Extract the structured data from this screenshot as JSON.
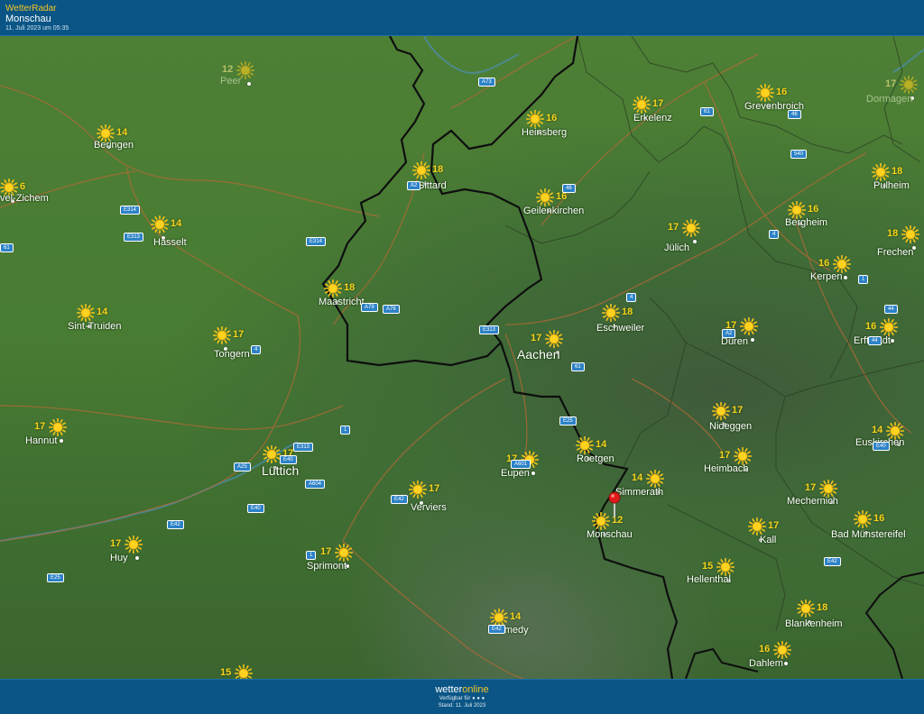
{
  "header": {
    "app_name": "WetterRadar",
    "location": "Monschau",
    "timestamp": "11. Juli 2023 um 05:35"
  },
  "footer": {
    "brand_prefix": "wetter",
    "brand_suffix": "online",
    "available": "Verfügbar für",
    "stand": "Stand: 11. Juli 2023"
  },
  "colors": {
    "header_bg": "#0a5585",
    "accent": "#f5c623",
    "map_green": "#4b7c34",
    "border": "#111111",
    "road_badge": "#2d82c6"
  },
  "pin": {
    "location": "Monschau",
    "icon": "map-pin-icon"
  },
  "cities": [
    {
      "name": "Peer",
      "temp": "12",
      "faded": true
    },
    {
      "name": "Beringen",
      "temp": "14"
    },
    {
      "name": "vel-Zichem",
      "temp": "6"
    },
    {
      "name": "Hasselt",
      "temp": "14"
    },
    {
      "name": "Sint-Truiden",
      "temp": "14"
    },
    {
      "name": "Tongern",
      "temp": "17"
    },
    {
      "name": "Hannut",
      "temp": "17"
    },
    {
      "name": "Lüttich",
      "temp": "17",
      "big": true
    },
    {
      "name": "Huy",
      "temp": "17"
    },
    {
      "name": "Sprimont",
      "temp": "17"
    },
    {
      "name": "Maastricht",
      "temp": "18"
    },
    {
      "name": "Sittard",
      "temp": "18"
    },
    {
      "name": "Heinsberg",
      "temp": "16"
    },
    {
      "name": "Erkelenz",
      "temp": "17"
    },
    {
      "name": "Grevenbroich",
      "temp": "16"
    },
    {
      "name": "Dormagen",
      "temp": "17",
      "faded": true
    },
    {
      "name": "Geilenkirchen",
      "temp": "16"
    },
    {
      "name": "Jülich",
      "temp": "17"
    },
    {
      "name": "Bergheim",
      "temp": "16"
    },
    {
      "name": "Pulheim",
      "temp": "18"
    },
    {
      "name": "Frechen",
      "temp": "18"
    },
    {
      "name": "Kerpen",
      "temp": "16"
    },
    {
      "name": "Aachen",
      "temp": "17",
      "big": true
    },
    {
      "name": "Eschweiler",
      "temp": "18"
    },
    {
      "name": "Düren",
      "temp": "17"
    },
    {
      "name": "Erftstadt",
      "temp": "16"
    },
    {
      "name": "Nideggen",
      "temp": "17"
    },
    {
      "name": "Euskirchen",
      "temp": "14"
    },
    {
      "name": "Heimbach",
      "temp": "17"
    },
    {
      "name": "Eupen",
      "temp": "17"
    },
    {
      "name": "Roetgen",
      "temp": "14"
    },
    {
      "name": "Simmerath",
      "temp": "14"
    },
    {
      "name": "Monschau",
      "temp": "12"
    },
    {
      "name": "Verviers",
      "temp": "17"
    },
    {
      "name": "Mechernich",
      "temp": "17"
    },
    {
      "name": "Kall",
      "temp": "17"
    },
    {
      "name": "Bad Münstereifel",
      "temp": "16"
    },
    {
      "name": "Hellenthal",
      "temp": "15"
    },
    {
      "name": "Blankenheim",
      "temp": "18"
    },
    {
      "name": "Malmedy",
      "temp": "14"
    },
    {
      "name": "Dahlem",
      "temp": "16"
    },
    {
      "name": "",
      "temp": "15"
    }
  ],
  "roads": [
    "A73",
    "61",
    "46",
    "540",
    "A2",
    "46",
    "E314",
    "E313",
    "E314",
    "61",
    "4",
    "1",
    "44",
    "4",
    "A2",
    "A79",
    "A76",
    "E313",
    "4",
    "61",
    "44",
    "E25",
    "1",
    "E40",
    "A601",
    "E313",
    "E40",
    "A25",
    "A604",
    "E40",
    "E42",
    "E42",
    "E25",
    "1",
    "E42",
    "E42",
    "1"
  ]
}
